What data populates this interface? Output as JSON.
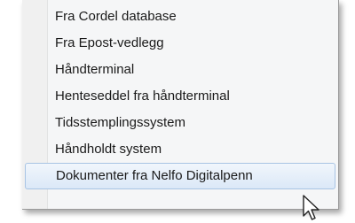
{
  "menu": {
    "items": [
      {
        "label": "Fra Cordel database"
      },
      {
        "label": "Fra Epost-vedlegg"
      },
      {
        "label": "Håndterminal"
      },
      {
        "label": "Henteseddel fra håndterminal"
      },
      {
        "label": "Tidsstemplingssystem"
      },
      {
        "label": "Håndholdt system"
      },
      {
        "label": "Dokumenter fra Nelfo Digitalpenn"
      }
    ],
    "hovered_index": 6
  },
  "icons": {
    "cursor": "arrow-cursor-icon"
  }
}
